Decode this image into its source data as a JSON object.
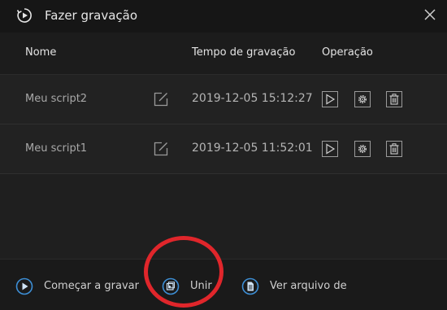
{
  "window": {
    "title": "Fazer gravação",
    "title_icon": "record-play-icon",
    "close_icon": "close-icon"
  },
  "table": {
    "headers": {
      "name": "Nome",
      "time": "Tempo de gravação",
      "operation": "Operação"
    },
    "rows": [
      {
        "name": "Meu script2",
        "time": "2019-12-05 15:12:27"
      },
      {
        "name": "Meu script1",
        "time": "2019-12-05 11:52:01"
      }
    ],
    "row_icons": [
      "edit-icon",
      "play-icon",
      "gear-icon",
      "trash-icon"
    ]
  },
  "footer": {
    "record_label": "Começar a gravar",
    "merge_label": "Unir",
    "view_label": "Ver arquivo de"
  },
  "colors": {
    "background": "#1f1f1f",
    "titlebar": "#161616",
    "accent_blue": "#3d8fd6",
    "annotation_red": "#e0262b"
  }
}
